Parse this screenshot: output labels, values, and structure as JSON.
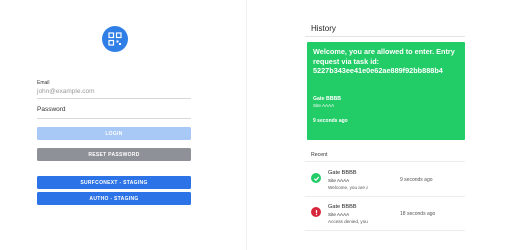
{
  "login": {
    "logo_icon": "qr-code-icon",
    "email_label": "Email",
    "email_placeholder": "john@example.com",
    "password_placeholder": "Password",
    "login_button": "LOGIN",
    "reset_button": "RESET PASSWORD",
    "surfconext_button": "SURFCONEXT - STAGING",
    "autho_button": "AUTHO - STAGING"
  },
  "history": {
    "title": "History",
    "banner": {
      "message": "Welcome, you are allowed to enter. Entry request via task id: 5227b343ee41e0e62ae889f92bb888b4",
      "gate": "Gate BBBB",
      "site": "Site AAAA",
      "time": "9 seconds ago",
      "color": "#22cc66"
    },
    "recent_label": "Recent",
    "items": [
      {
        "status_icon": "check-circle-icon",
        "status_color": "#22cc66",
        "gate": "Gate BBBB",
        "site": "Site AAAA",
        "message": "Welcome, you are allo...",
        "time": "9 seconds ago"
      },
      {
        "status_icon": "error-circle-icon",
        "status_color": "#d6263a",
        "gate": "Gate BBBB",
        "site": "Site AAAA",
        "message": "Access denied, your s...",
        "time": "18 seconds ago"
      }
    ]
  }
}
